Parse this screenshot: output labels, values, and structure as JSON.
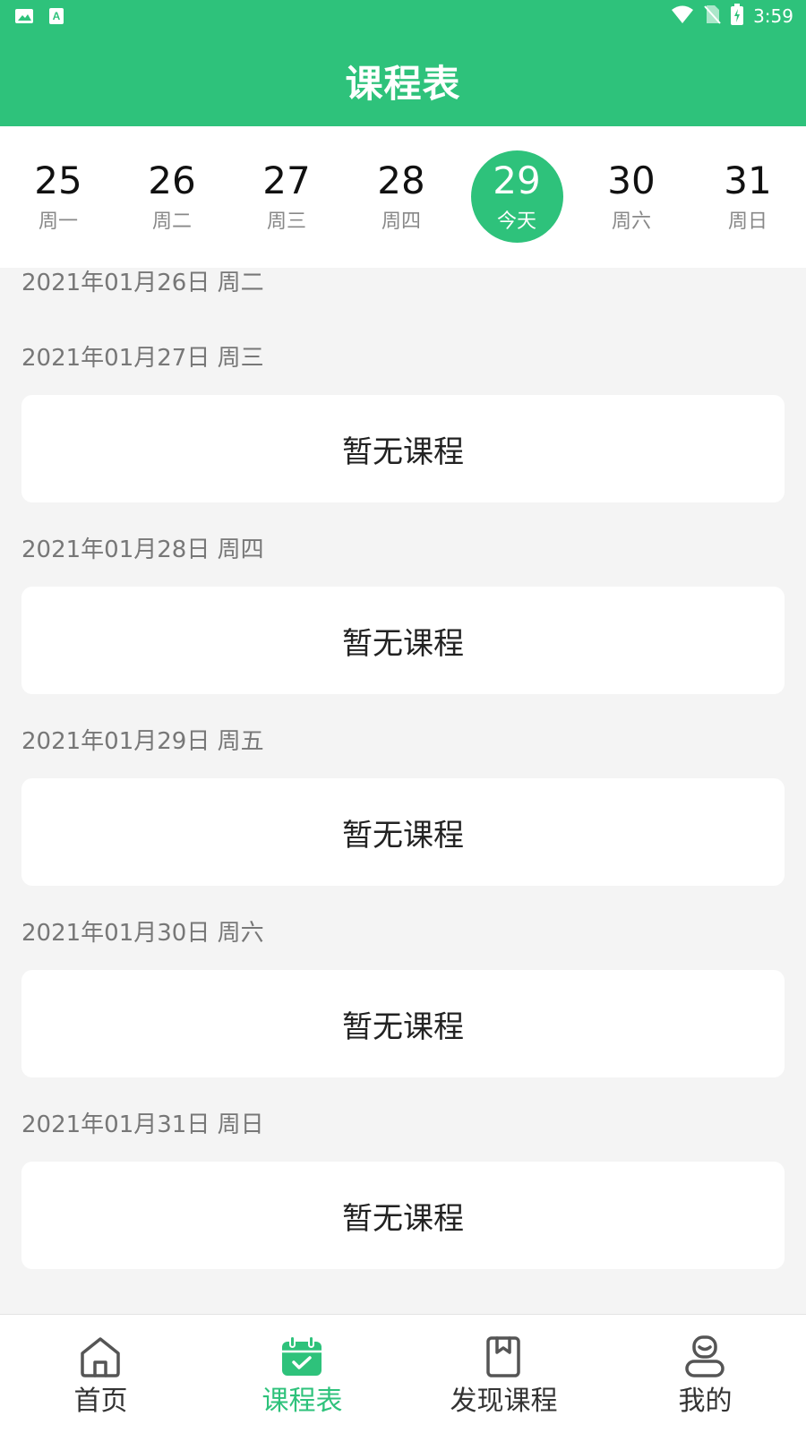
{
  "status_bar": {
    "time": "3:59",
    "icons": [
      "image-icon",
      "font-icon",
      "wifi-icon",
      "no-sim-icon",
      "battery-charging-icon"
    ]
  },
  "header": {
    "title": "课程表"
  },
  "week_strip": {
    "days": [
      {
        "num": "25",
        "label": "周一"
      },
      {
        "num": "26",
        "label": "周二"
      },
      {
        "num": "27",
        "label": "周三"
      },
      {
        "num": "28",
        "label": "周四"
      },
      {
        "num": "29",
        "label": "今天",
        "selected": true
      },
      {
        "num": "30",
        "label": "周六"
      },
      {
        "num": "31",
        "label": "周日"
      }
    ]
  },
  "schedule": {
    "empty_text": "暂无课程",
    "sections": [
      {
        "date": "2021年01月26日 周二"
      },
      {
        "date": "2021年01月27日 周三",
        "card": "暂无课程"
      },
      {
        "date": "2021年01月28日 周四",
        "card": "暂无课程"
      },
      {
        "date": "2021年01月29日 周五",
        "card": "暂无课程"
      },
      {
        "date": "2021年01月30日 周六",
        "card": "暂无课程"
      },
      {
        "date": "2021年01月31日 周日",
        "card": "暂无课程"
      }
    ]
  },
  "bottom_nav": {
    "items": [
      {
        "label": "首页",
        "icon": "home-icon"
      },
      {
        "label": "课程表",
        "icon": "calendar-icon",
        "active": true
      },
      {
        "label": "发现课程",
        "icon": "book-icon"
      },
      {
        "label": "我的",
        "icon": "user-icon"
      }
    ]
  },
  "colors": {
    "accent": "#2ec27b",
    "background": "#f4f4f4",
    "card": "#ffffff"
  }
}
